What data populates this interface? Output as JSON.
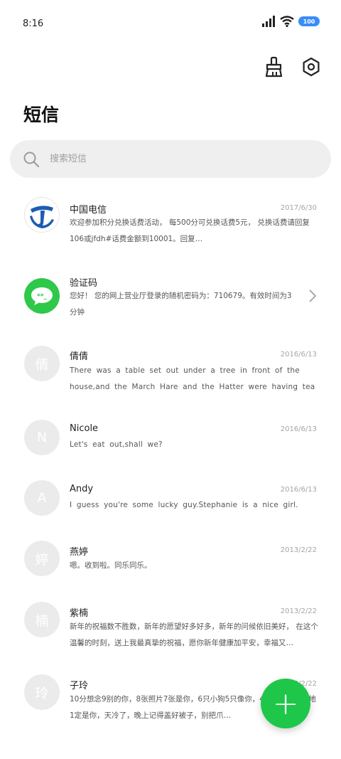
{
  "status_bar": {
    "time": "8:16",
    "battery": "100"
  },
  "colors": {
    "accent": "#1ec74a",
    "battery": "#3a8df5",
    "telecom": "#1b5db2"
  },
  "header": {
    "title": "短信",
    "clean_icon": "broom-icon",
    "settings_icon": "hexagon-gear-icon"
  },
  "search": {
    "placeholder": "搜索短信"
  },
  "messages": [
    {
      "name": "中国电信",
      "date": "2017/6/30",
      "avatar": "china-telecom-logo",
      "preview": "欢迎参加积分兑换话费活动， 每500分可兑换话费5元， 兑换话费请回复106或jfdh#话费金额到10001。回复…"
    },
    {
      "name": "验证码",
      "date": "",
      "avatar": "verification-code-icon",
      "preview": "您好！ 您的网上营业厅登录的随机密码为：710679。有效时间为3分钟"
    },
    {
      "name": "倩倩",
      "date": "2016/6/13",
      "avatar_text": "倩",
      "preview": "There was a table set out under a tree in front of the house,and the March Hare and the Hatter were having tea at it."
    },
    {
      "name": "Nicole",
      "date": "2016/6/13",
      "avatar_text": "N",
      "preview": "Let's eat out,shall we?"
    },
    {
      "name": "Andy",
      "date": "2016/6/13",
      "avatar_text": "A",
      "preview": "I guess you're some lucky guy.Stephanie is a nice girl."
    },
    {
      "name": "燕婷",
      "date": "2013/2/22",
      "avatar_text": "婷",
      "preview": "嗯。收到啦。同乐同乐。"
    },
    {
      "name": "紫楠",
      "date": "2013/2/22",
      "avatar_text": "楠",
      "preview": "新年的祝福数不胜数，新年的愿望好多好多，新年的问候依旧美好， 在这个温馨的时刻，送上我最真挚的祝福，愿你新年健康加平安，幸福又…"
    },
    {
      "name": "子玲",
      "date": "2013/2/22",
      "avatar_text": "玲",
      "preview": "10分想念9别的你，8张照片7张是你，6只小狗5只像你，4… 你，2爪着地1定是你，天冷了，晚上记得盖好被子，别把爪…"
    }
  ],
  "fab": {
    "label": "+"
  }
}
